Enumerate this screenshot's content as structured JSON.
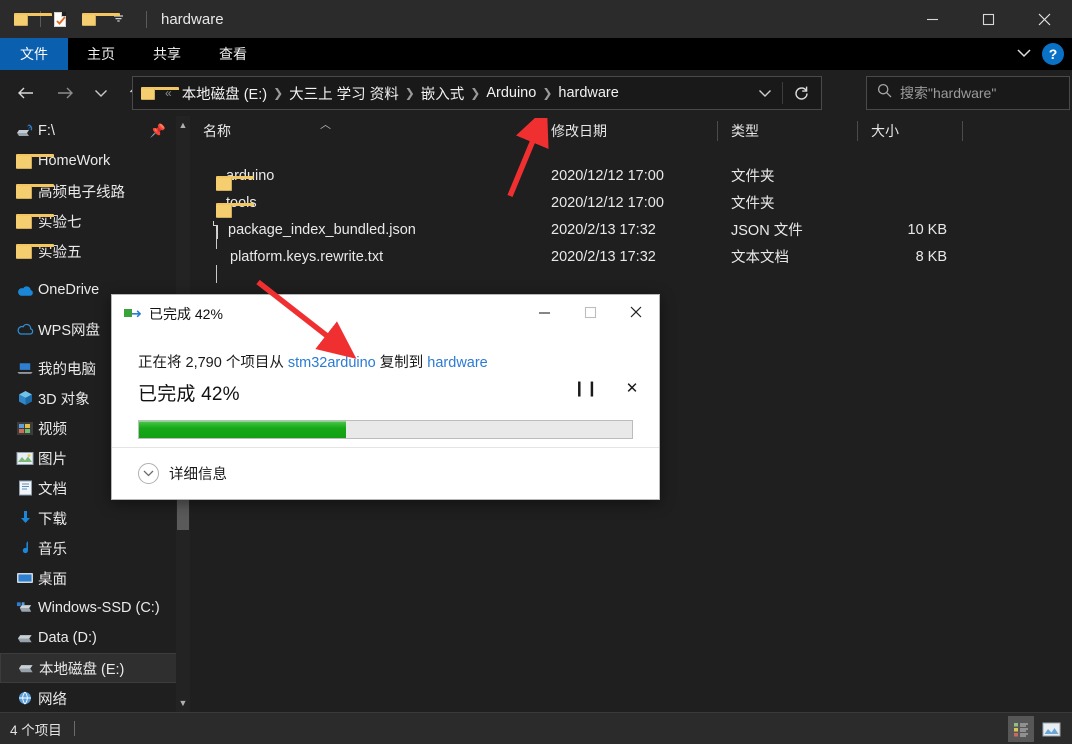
{
  "window": {
    "title": "hardware",
    "quick_access": [
      "folder-icon",
      "properties-icon",
      "new-folder-icon",
      "customize-dropdown-icon"
    ],
    "controls": {
      "minimize": "minimize-icon",
      "maximize": "maximize-icon",
      "close": "close-icon"
    }
  },
  "ribbon": {
    "file_tab": "文件",
    "tabs": [
      {
        "label": "主页"
      },
      {
        "label": "共享"
      },
      {
        "label": "查看"
      }
    ],
    "collapse_icon": "chevron-down-icon",
    "help_label": "?"
  },
  "nav": {
    "back_icon": "arrow-left-icon",
    "forward_icon": "arrow-right-icon",
    "recent_icon": "chevron-down-icon",
    "up_icon": "arrow-up-icon",
    "refresh_icon": "refresh-icon",
    "dropdown_icon": "chevron-down-icon",
    "overflow": "«",
    "breadcrumbs": [
      {
        "label": "本地磁盘 (E:)"
      },
      {
        "label": "大三上 学习 资料"
      },
      {
        "label": "嵌入式"
      },
      {
        "label": "Arduino"
      },
      {
        "label": "hardware"
      }
    ]
  },
  "search": {
    "icon": "search-icon",
    "placeholder": "搜索\"hardware\""
  },
  "sidebar": {
    "scroll_up_icon": "chevron-up-icon",
    "scroll_down_icon": "chevron-down-icon",
    "groups": [
      {
        "items": [
          {
            "label": "F:\\",
            "icon": "network-drive-icon",
            "pinned": true,
            "selected": false
          },
          {
            "label": "HomeWork",
            "icon": "folder-icon",
            "selected": false
          },
          {
            "label": "高频电子线路",
            "icon": "folder-icon",
            "selected": false
          },
          {
            "label": "实验七",
            "icon": "folder-icon",
            "selected": false
          },
          {
            "label": "实验五",
            "icon": "folder-icon",
            "selected": false
          }
        ]
      },
      {
        "items": [
          {
            "label": "OneDrive",
            "icon": "onedrive-icon",
            "selected": false
          }
        ]
      },
      {
        "items": [
          {
            "label": "WPS网盘",
            "icon": "wps-cloud-icon",
            "selected": false
          }
        ]
      },
      {
        "items": [
          {
            "label": "我的电脑",
            "icon": "this-pc-icon",
            "selected": false
          },
          {
            "label": "3D 对象",
            "icon": "3d-objects-icon",
            "selected": false
          },
          {
            "label": "视频",
            "icon": "videos-icon",
            "selected": false
          },
          {
            "label": "图片",
            "icon": "pictures-icon",
            "selected": false
          },
          {
            "label": "文档",
            "icon": "documents-icon",
            "selected": false
          },
          {
            "label": "下载",
            "icon": "downloads-icon",
            "selected": false
          },
          {
            "label": "音乐",
            "icon": "music-icon",
            "selected": false
          },
          {
            "label": "桌面",
            "icon": "desktop-icon",
            "selected": false
          },
          {
            "label": "Windows-SSD (C:)",
            "icon": "system-drive-icon",
            "selected": false
          },
          {
            "label": "Data (D:)",
            "icon": "drive-icon",
            "selected": false
          },
          {
            "label": "本地磁盘 (E:)",
            "icon": "drive-icon",
            "selected": true
          },
          {
            "label": "网络",
            "icon": "network-icon",
            "selected": false
          }
        ]
      }
    ]
  },
  "filelist": {
    "columns": [
      {
        "label": "名称",
        "sort": "asc"
      },
      {
        "label": "修改日期"
      },
      {
        "label": "类型"
      },
      {
        "label": "大小"
      }
    ],
    "rows": [
      {
        "icon": "folder-icon",
        "name": "arduino",
        "date": "2020/12/12 17:00",
        "type": "文件夹",
        "size": ""
      },
      {
        "icon": "folder-icon",
        "name": "tools",
        "date": "2020/12/12 17:00",
        "type": "文件夹",
        "size": ""
      },
      {
        "icon": "json-file-icon",
        "name": "package_index_bundled.json",
        "date": "2020/2/13 17:32",
        "type": "JSON 文件",
        "size": "10 KB"
      },
      {
        "icon": "text-file-icon",
        "name": "platform.keys.rewrite.txt",
        "date": "2020/2/13 17:32",
        "type": "文本文档",
        "size": "8 KB"
      }
    ]
  },
  "statusbar": {
    "count_text": "4 个项目",
    "view_details_icon": "details-view-icon",
    "view_thumbnails_icon": "thumbnails-view-icon"
  },
  "copy_dialog": {
    "title": "已完成 42%",
    "title_icon": "copy-progress-icon",
    "controls": {
      "minimize": "minimize-icon",
      "maximize": "maximize-icon",
      "close": "close-icon"
    },
    "message_prefix": "正在将 2,790 个项目从 ",
    "source": "stm32arduino",
    "message_middle": " 复制到 ",
    "destination": "hardware",
    "progress_label": "已完成 42%",
    "progress_percent": 42,
    "pause_icon": "pause-icon",
    "cancel_icon": "cancel-icon",
    "details_label": "详细信息",
    "details_chevron": "chevron-down-icon",
    "accent_green": "#17a817",
    "link_blue": "#2b7bd4"
  },
  "annotations": [
    {
      "name": "arrow-to-date-column",
      "color": "#f03030"
    },
    {
      "name": "arrow-to-source-folder",
      "color": "#f03030"
    }
  ]
}
